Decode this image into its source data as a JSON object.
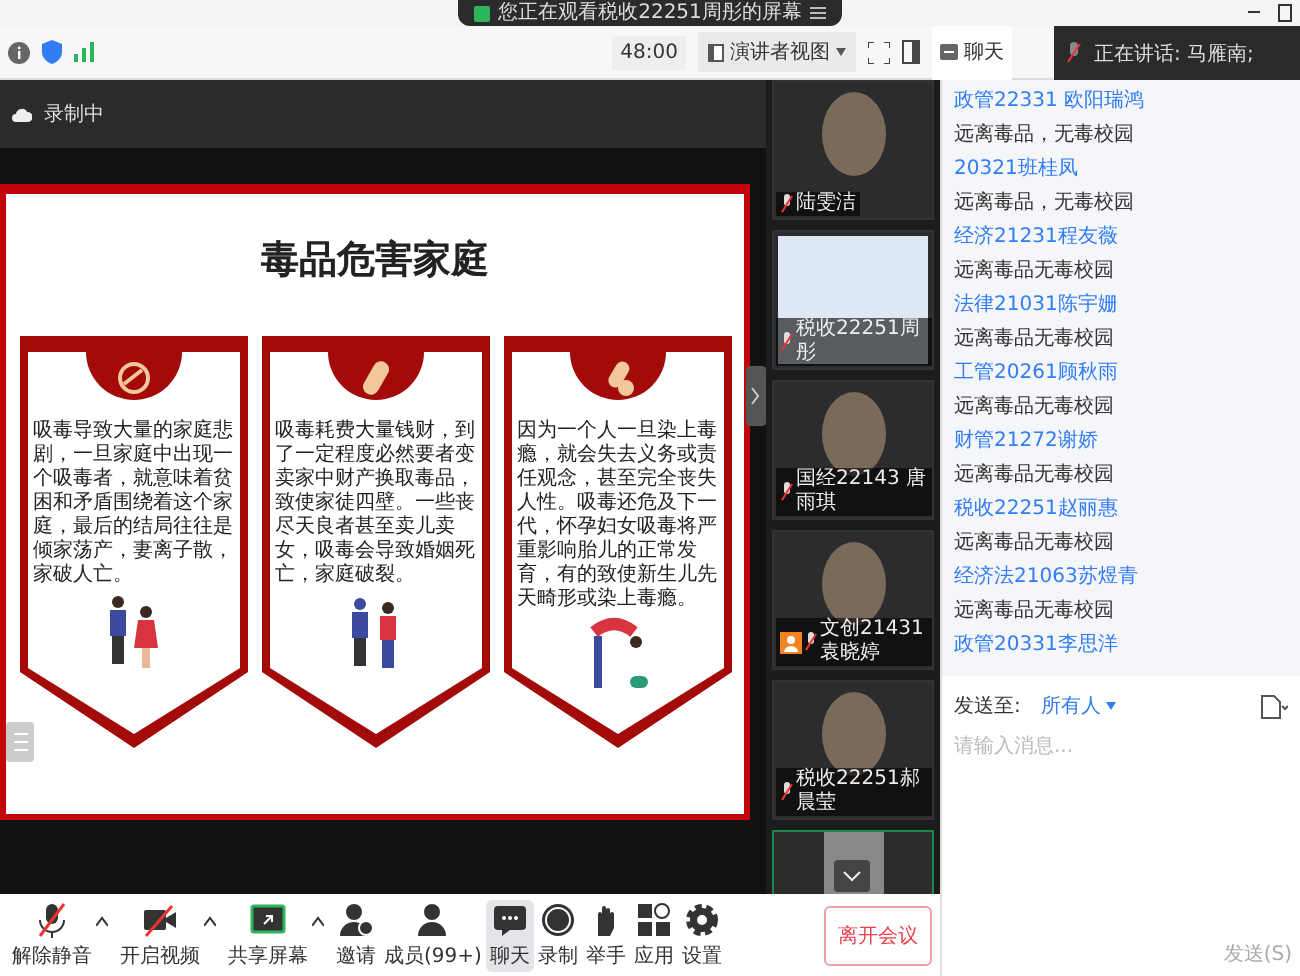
{
  "banner": {
    "text": "您正在观看税收22251周彤的屏幕"
  },
  "toolbar": {
    "timer": "48:00",
    "view_mode": "演讲者视图",
    "chat_tab": "聊天"
  },
  "speaking": {
    "text": "正在讲话: 马雁南;"
  },
  "recording": {
    "label": "录制中"
  },
  "slide": {
    "title": "毒品危害家庭",
    "cards": [
      {
        "kind": "round-pill",
        "text": "吸毒导致大量的家庭悲剧，一旦家庭中出现一个吸毒者，就意味着贫困和矛盾围绕着这个家庭，最后的结局往往是倾家荡产，妻离子散，家破人亡。"
      },
      {
        "kind": "capsule",
        "text": "吸毒耗费大量钱财，到了一定程度必然要者变卖家中财产换取毒品，致使家徒四壁。一些丧尽天良者甚至卖儿卖女，吸毒会导致婚姻死亡，家庭破裂。"
      },
      {
        "kind": "pills",
        "text": "因为一个人一旦染上毒瘾，就会失去义务或责任观念，甚至完全丧失人性。吸毒还危及下一代，怀孕妇女吸毒将严重影响胎儿的正常发育，有的致使新生儿先天畸形或染上毒瘾。"
      }
    ]
  },
  "participants": [
    {
      "kind": "avatar",
      "name": "陆雯洁",
      "muted": true,
      "host": false
    },
    {
      "kind": "screen",
      "name": "税收22251周彤",
      "muted": true,
      "host": false
    },
    {
      "kind": "avatar",
      "name": "国经22143 唐雨琪",
      "muted": true,
      "host": false
    },
    {
      "kind": "avatar",
      "name": "文创21431袁晓婷",
      "muted": true,
      "host": true
    },
    {
      "kind": "avatar",
      "name": "税收22251郝晨莹",
      "muted": true,
      "host": false
    },
    {
      "kind": "video",
      "muted": false,
      "host": false
    }
  ],
  "chat": {
    "messages": [
      {
        "kind": "sender",
        "text": "政管22331 欧阳瑞鸿"
      },
      {
        "kind": "message",
        "text": "远离毒品，无毒校园"
      },
      {
        "kind": "sender",
        "text": "20321班桂凤"
      },
      {
        "kind": "message",
        "text": "远离毒品，无毒校园"
      },
      {
        "kind": "sender",
        "text": "经济21231程友薇"
      },
      {
        "kind": "message",
        "text": "远离毒品无毒校园"
      },
      {
        "kind": "sender",
        "text": "法律21031陈宇姗"
      },
      {
        "kind": "message",
        "text": "远离毒品无毒校园"
      },
      {
        "kind": "sender",
        "text": "工管20261顾秋雨"
      },
      {
        "kind": "message",
        "text": "远离毒品无毒校园"
      },
      {
        "kind": "sender",
        "text": "财管21272谢娇"
      },
      {
        "kind": "message",
        "text": "远离毒品无毒校园"
      },
      {
        "kind": "sender",
        "text": "税收22251赵丽惠"
      },
      {
        "kind": "message",
        "text": "远离毒品无毒校园"
      },
      {
        "kind": "sender",
        "text": "经济法21063苏煜青"
      },
      {
        "kind": "message",
        "text": "远离毒品无毒校园"
      },
      {
        "kind": "sender",
        "text": "政管20331李思洋"
      }
    ],
    "send_to_label": "发送至:",
    "recipient": "所有人",
    "placeholder": "请输入消息...",
    "send_button": "发送(S)"
  },
  "controls": [
    {
      "label": "解除静音",
      "caret": true,
      "selected": false
    },
    {
      "label": "开启视频",
      "caret": true,
      "selected": false
    },
    {
      "label": "共享屏幕",
      "caret": true,
      "selected": false
    },
    {
      "label": "邀请",
      "caret": false,
      "selected": false
    },
    {
      "label": "成员(99+)",
      "caret": false,
      "selected": false
    },
    {
      "label": "聊天",
      "caret": false,
      "selected": true
    },
    {
      "label": "录制",
      "caret": false,
      "selected": false
    },
    {
      "label": "举手",
      "caret": false,
      "selected": false
    },
    {
      "label": "应用",
      "caret": false,
      "selected": false
    },
    {
      "label": "设置",
      "caret": false,
      "selected": false
    }
  ],
  "leave_button": "离开会议"
}
